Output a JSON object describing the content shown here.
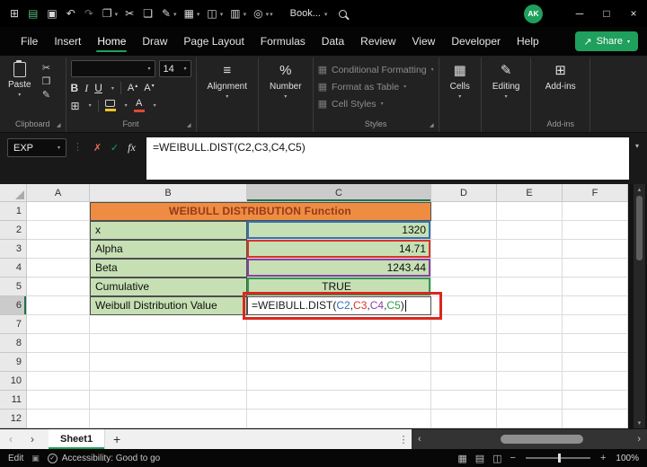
{
  "colors": {
    "accent_green": "#1FA05C",
    "title_fill": "#EE8C42",
    "title_text": "#96391B",
    "cell_green": "#C6E0B4",
    "annotation_red": "#DC261E",
    "formula_text": "#1A1A1A",
    "ref_blue": "#2E75B6",
    "ref_red": "#D9342B",
    "ref_purple": "#8A3FA8",
    "ref_green": "#2E9B4E"
  },
  "icons": {
    "chevron_down": "▾",
    "chevron_up": "▴",
    "dots_vertical": "⋮",
    "nav_left": "‹",
    "nav_right": "›",
    "minimize": "─",
    "maximize": "□",
    "close": "×",
    "check": "✓",
    "cancel": "✗",
    "cut": "✂",
    "copy": "❐",
    "format_painter": "✎",
    "launcher": "◢",
    "borders": "⊞",
    "align": "≡",
    "grid_small": "▦",
    "cells": "▦",
    "editing": "✎",
    "addins": "⊞",
    "share_arrow": "↗",
    "macro": "▣",
    "view_normal": "▦",
    "view_layout": "▤",
    "view_break": "◫",
    "minus": "−",
    "plus": "+"
  },
  "titlebar": {
    "workbook_name": "Book...",
    "avatar_initials": "AK",
    "quick_icons": [
      {
        "name": "app-launcher-icon",
        "glyph": "⊞"
      },
      {
        "name": "autosave-icon",
        "glyph": "▤",
        "accent": true
      },
      {
        "name": "save-icon",
        "glyph": "▣"
      },
      {
        "name": "undo-icon",
        "glyph": "↶"
      },
      {
        "name": "redo-icon",
        "glyph": "↷",
        "dim": true
      },
      {
        "name": "paste-quick-icon",
        "glyph": "❐",
        "chevron": true
      },
      {
        "name": "cut-quick-icon",
        "glyph": "✂"
      },
      {
        "name": "copy-quick-icon",
        "glyph": "❏"
      },
      {
        "name": "format-painter-quick-icon",
        "glyph": "✎",
        "chevron": true
      },
      {
        "name": "table-quick-icon",
        "glyph": "▦",
        "chevron": true
      },
      {
        "name": "picture-quick-icon",
        "glyph": "◫",
        "chevron": true
      },
      {
        "name": "chart-quick-icon",
        "glyph": "▥",
        "chevron": true
      },
      {
        "name": "zoom-quick-icon",
        "glyph": "◎",
        "chevron": true
      }
    ]
  },
  "menubar": {
    "items": [
      "File",
      "Insert",
      "Home",
      "Draw",
      "Page Layout",
      "Formulas",
      "Data",
      "Review",
      "View",
      "Developer",
      "Help"
    ],
    "active": "Home",
    "share_label": "Share"
  },
  "ribbon": {
    "paste_label": "Paste",
    "font_name": "",
    "font_size": "14",
    "font_letter": "A",
    "bold": "B",
    "italic": "I",
    "underline": "U",
    "alignment_label": "Alignment",
    "number_label": "Number",
    "percent": "%",
    "styles_items": [
      "Conditional Formatting",
      "Format as Table",
      "Cell Styles"
    ],
    "cells_label": "Cells",
    "editing_label": "Editing",
    "addins_label": "Add-ins",
    "group_labels": {
      "clipboard": "Clipboard",
      "font": "Font",
      "styles": "Styles",
      "addins": "Add-ins"
    }
  },
  "formula_bar": {
    "name_box": "EXP",
    "fx": "fx",
    "formula": "=WEIBULL.DIST(C2,C3,C4,C5)"
  },
  "grid": {
    "columns": [
      "A",
      "B",
      "C",
      "D",
      "E",
      "F"
    ],
    "row_count": 12,
    "selected_column": "C",
    "selected_row": 6,
    "title": "WEIBULL DISTRIBUTION Function",
    "data_rows": [
      {
        "row": 2,
        "label": "x",
        "value": "1320",
        "align": "right",
        "ref": "ref_blue"
      },
      {
        "row": 3,
        "label": "Alpha",
        "value": "14.71",
        "align": "right",
        "ref": "ref_red"
      },
      {
        "row": 4,
        "label": "Beta",
        "value": "1243.44",
        "align": "right",
        "ref": "ref_purple"
      },
      {
        "row": 5,
        "label": "Cumulative",
        "value": "TRUE",
        "align": "center",
        "ref": "ref_green"
      },
      {
        "row": 6,
        "label": "Weibull Distribution Value"
      }
    ],
    "formula_parts": [
      {
        "text": "=WEIBULL.DIST(",
        "color": "formula_text"
      },
      {
        "text": "C2",
        "color": "ref_blue"
      },
      {
        "text": ",",
        "color": "formula_text"
      },
      {
        "text": "C3",
        "color": "ref_red"
      },
      {
        "text": ",",
        "color": "formula_text"
      },
      {
        "text": "C4",
        "color": "ref_purple"
      },
      {
        "text": ",",
        "color": "formula_text"
      },
      {
        "text": "C5",
        "color": "ref_green"
      },
      {
        "text": ")",
        "color": "formula_text"
      }
    ]
  },
  "sheet_tabs": {
    "active_tab": "Sheet1",
    "add_label": "+"
  },
  "status_bar": {
    "mode": "Edit",
    "accessibility": "Accessibility: Good to go",
    "zoom": "100%"
  }
}
